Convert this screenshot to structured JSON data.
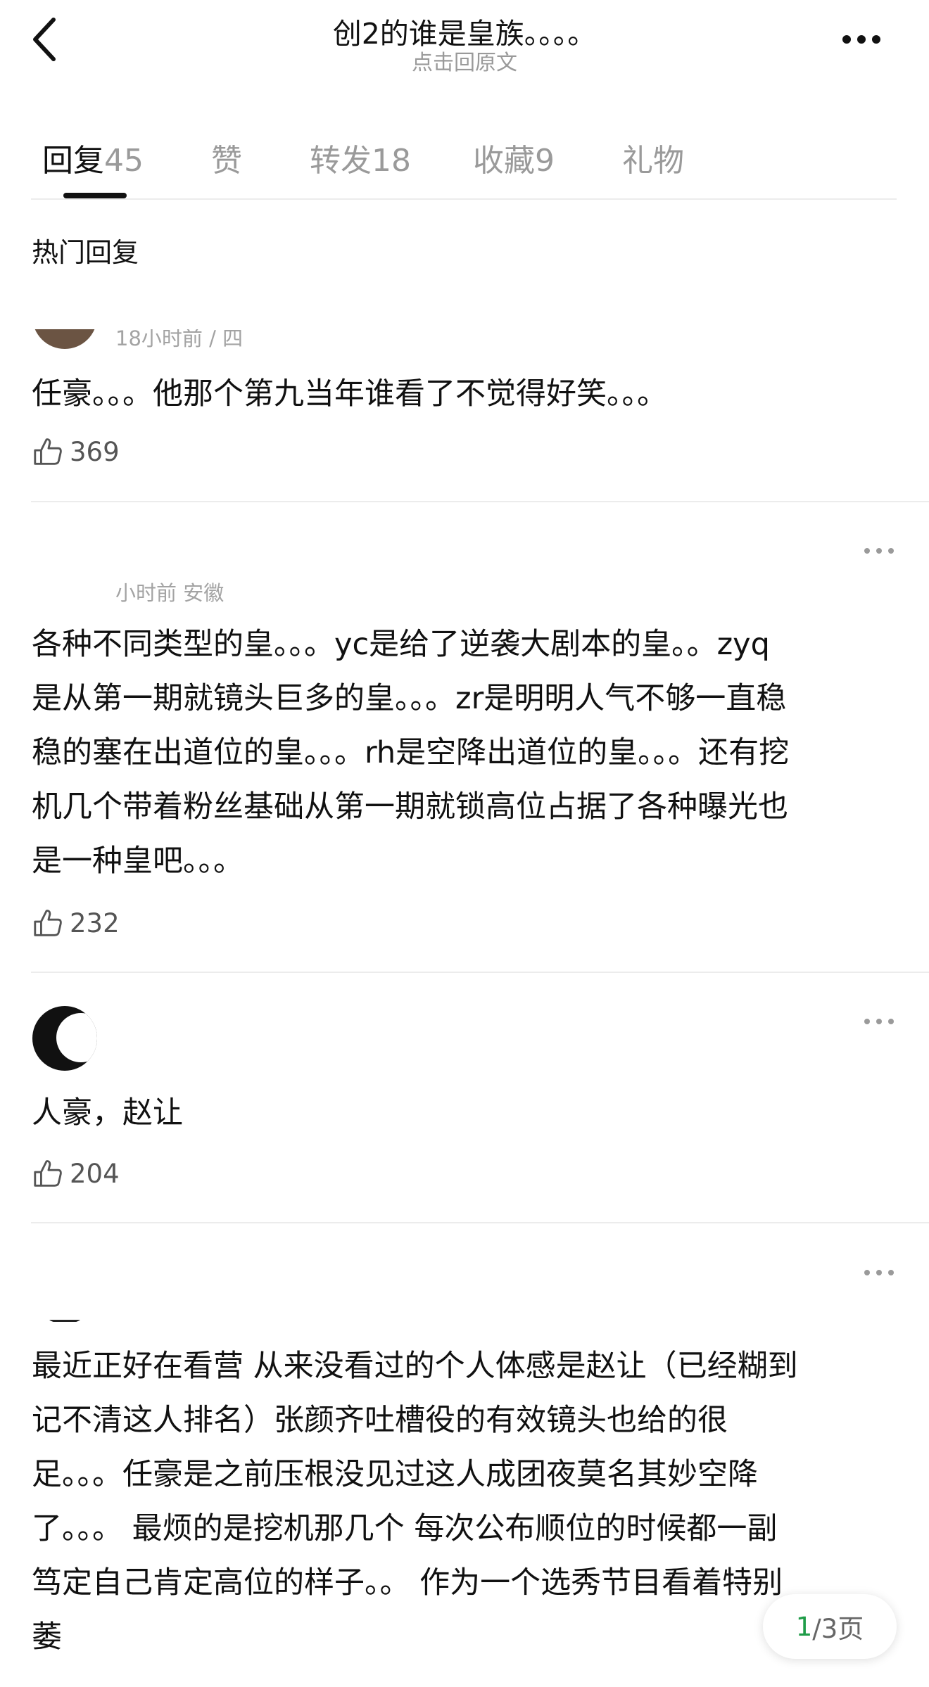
{
  "header": {
    "title": "创2的谁是皇族。。。。",
    "subtitle": "点击回原文"
  },
  "tabs": [
    {
      "label": "回复",
      "count": "45",
      "active": true
    },
    {
      "label": "赞",
      "count": "",
      "active": false
    },
    {
      "label": "转发",
      "count": "18",
      "active": false
    },
    {
      "label": "收藏",
      "count": "9",
      "active": false
    },
    {
      "label": "礼物",
      "count": "",
      "active": false
    }
  ],
  "section_heading": "热门回复",
  "comments": [
    {
      "meta": "18小时前 / 四",
      "text": "任豪。。。他那个第九当年谁看了不觉得好笑。。。",
      "likes": "369"
    },
    {
      "meta": "小时前 安徽",
      "text": "各种不同类型的皇。。。yc是给了逆袭大剧本的皇。。zyq\n是从第一期就镜头巨多的皇。。。zr是明明人气不够一直稳\n稳的塞在出道位的皇。。。rh是空降出道位的皇。。。还有挖\n机几个带着粉丝基础从第一期就锁高位占据了各种曝光也\n是一种皇吧。。。",
      "likes": "232"
    },
    {
      "meta": "",
      "text": "人豪，赵让",
      "likes": "204"
    },
    {
      "meta": "",
      "text": "最近正好在看营 从来没看过的个人体感是赵让（已经糊到\n记不清这人排名）张颜齐吐槽役的有效镜头也给的很\n足。。。任豪是之前压根没见过这人成团夜莫名其妙空降\n了。。。 最烦的是挖机那几个 每次公布顺位的时候都一副\n笃定自己肯定高位的样子。。 作为一个选秀节目看着特别\n萎",
      "likes": ""
    }
  ],
  "pager": {
    "current": "1",
    "total": "/3页"
  },
  "colors": {
    "accent_green": "#1f9c48",
    "text": "#111111",
    "muted": "#9a9a9a",
    "divider": "#ececec"
  }
}
